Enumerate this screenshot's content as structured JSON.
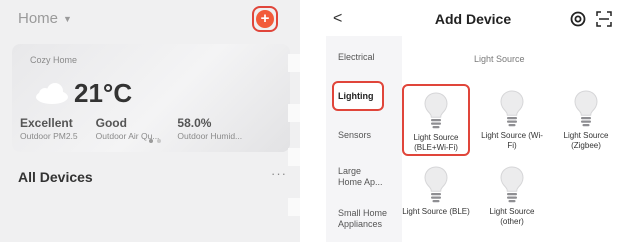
{
  "home": {
    "title": "Home",
    "weather": {
      "home_name": "Cozy Home",
      "temperature": "21°C",
      "metrics": [
        {
          "value": "Excellent",
          "label": "Outdoor PM2.5"
        },
        {
          "value": "Good",
          "label": "Outdoor Air Qu..."
        },
        {
          "value": "58.0%",
          "label": "Outdoor Humid..."
        }
      ]
    },
    "section_label": "All Devices",
    "more_label": "···"
  },
  "add_device": {
    "back_label": "<",
    "title": "Add Device",
    "categories": [
      "Electrical",
      "Lighting",
      "Sensors",
      "Large Home Ap...",
      "Small Home Appliances"
    ],
    "selected_category": "Lighting",
    "section_title": "Light Source",
    "devices": [
      {
        "name": "Light Source (BLE+Wi-Fi)"
      },
      {
        "name": "Light Source (Wi-Fi)"
      },
      {
        "name": "Light Source (Zigbee)"
      },
      {
        "name": "Light Source (BLE)"
      },
      {
        "name": "Light Source (other)"
      }
    ]
  },
  "colors": {
    "accent": "#f25b3a",
    "highlight": "#e0453a",
    "text_dark": "#222222",
    "text_muted": "#8a8a8a"
  },
  "icons": [
    "caret-down-icon",
    "plus-icon",
    "cloud-icon",
    "back-icon",
    "at-icon",
    "scan-icon",
    "bulb-icon"
  ]
}
